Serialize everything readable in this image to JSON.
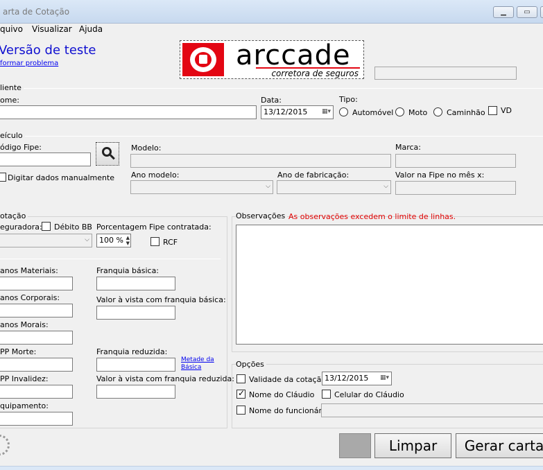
{
  "window": {
    "title": "arta de Cotação",
    "buttons": {
      "minimize": "▁",
      "maximize": "▭"
    }
  },
  "menu": {
    "items": [
      "quivo",
      "Visualizar",
      "Ajuda"
    ]
  },
  "header": {
    "version_text": "Versão de teste",
    "report_link": "formar problema",
    "logo_main": "arccade",
    "logo_sub": "corretora de seguros",
    "logo_accent": "#e30613",
    "status_field": ""
  },
  "cliente": {
    "group": "liente",
    "nome_label": "ome:",
    "nome_value": "",
    "data_label": "Data:",
    "data_value": "13/12/2015",
    "tipo_label": "Tipo:",
    "tipos": [
      "Automóvel",
      "Moto",
      "Caminhão",
      "VD"
    ]
  },
  "veiculo": {
    "group": "eículo",
    "codigo_label": "ódigo Fipe:",
    "codigo_value": "",
    "search_icon": "magnifier-icon",
    "manual_label": "Digitar dados manualmente",
    "modelo_label": "Modelo:",
    "marca_label": "Marca:",
    "ano_modelo_label": "Ano modelo:",
    "ano_fab_label": "Ano de fabricação:",
    "valor_fipe_label": "Valor na Fipe no mês x:"
  },
  "cotacao": {
    "group": "otação",
    "seguradora_label": "eguradora:",
    "debito_label": "Débito BB",
    "porcentagem_label": "Porcentagem Fipe contratada:",
    "porcentagem_value": "100 %",
    "rcf_label": "RCF",
    "danos_materiais": "anos Materiais:",
    "danos_corporais": "anos Corporais:",
    "danos_morais": "anos Morais:",
    "app_morte": "PP Morte:",
    "app_invalidez": "PP Invalidez:",
    "equipamento": "quipamento:",
    "franquia_basica": "Franquia básica:",
    "valor_vista_basica": "Valor à vista com franquia básica:",
    "franquia_reduzida": "Franquia reduzida:",
    "metade_link_1": "Metade da",
    "metade_link_2": "Básica",
    "valor_vista_reduzida": "Valor à vista com franquia reduzida:"
  },
  "observacoes": {
    "label": "Observações",
    "warning": "As observações excedem o limite de linhas.",
    "warning_color": "#e00000",
    "text": ""
  },
  "opcoes": {
    "group": "Opções",
    "validade_label": "Validade da cotação:",
    "validade_value": "13/12/2015",
    "nome_claudio": "Nome do Cláudio",
    "nome_claudio_checked": true,
    "celular_claudio": "Celular do Cláudio",
    "nome_funcionario": "Nome do funcionário:"
  },
  "actions": {
    "limpar": "Limpar",
    "gerar": "Gerar carta"
  }
}
